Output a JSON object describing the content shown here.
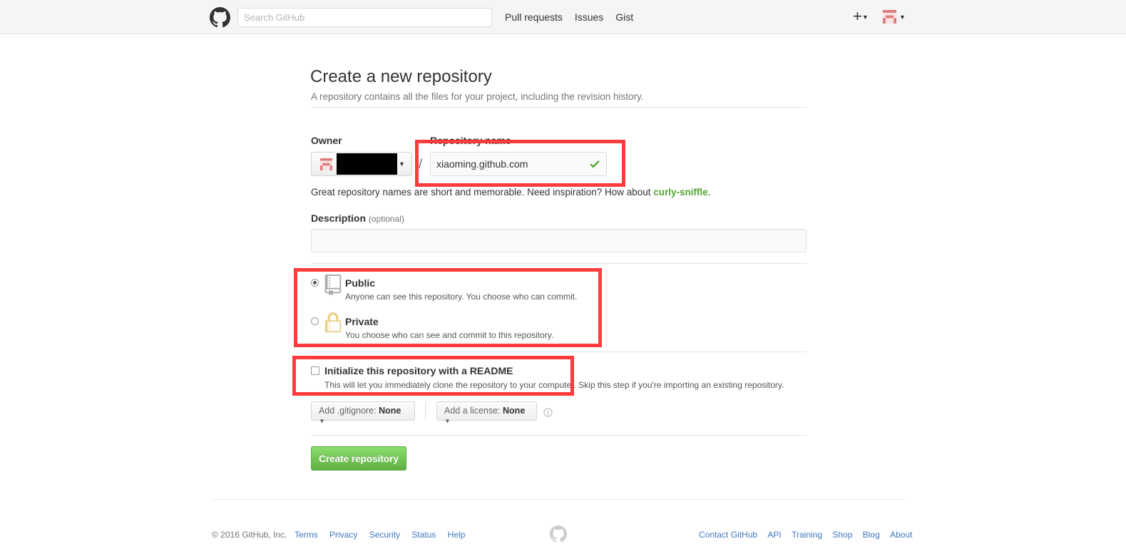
{
  "header": {
    "search_placeholder": "Search GitHub",
    "nav": [
      "Pull requests",
      "Issues",
      "Gist"
    ],
    "plus_label": "+"
  },
  "page": {
    "title": "Create a new repository",
    "subtitle": "A repository contains all the files for your project, including the revision history."
  },
  "form": {
    "owner_label": "Owner",
    "repo_label": "Repository name",
    "slash": "/",
    "repo_value": "xiaoming.github.com",
    "hint_prefix": "Great repository names are short and memorable. Need inspiration? How about",
    "hint_suggestion": "curly-sniffle",
    "hint_suffix": ".",
    "description_label": "Description",
    "description_optional": "(optional)",
    "public_title": "Public",
    "public_desc": "Anyone can see this repository. You choose who can commit.",
    "private_title": "Private",
    "private_desc": "You choose who can see and commit to this repository.",
    "readme_title": "Initialize this repository with a README",
    "readme_desc": "This will let you immediately clone the repository to your computer. Skip this step if you're importing an existing repository.",
    "gitignore_label": "Add .gitignore:",
    "gitignore_value": "None",
    "license_label": "Add a license:",
    "license_value": "None",
    "create_button": "Create repository"
  },
  "footer": {
    "copyright": "© 2016 GitHub, Inc.",
    "left_links": [
      "Terms",
      "Privacy",
      "Security",
      "Status",
      "Help"
    ],
    "right_links": [
      "Contact GitHub",
      "API",
      "Training",
      "Shop",
      "Blog",
      "About"
    ]
  },
  "colors": {
    "annotation": "#ff3b3b",
    "create_button": "#60b044",
    "link": "#4078c0",
    "check": "#55a532"
  }
}
